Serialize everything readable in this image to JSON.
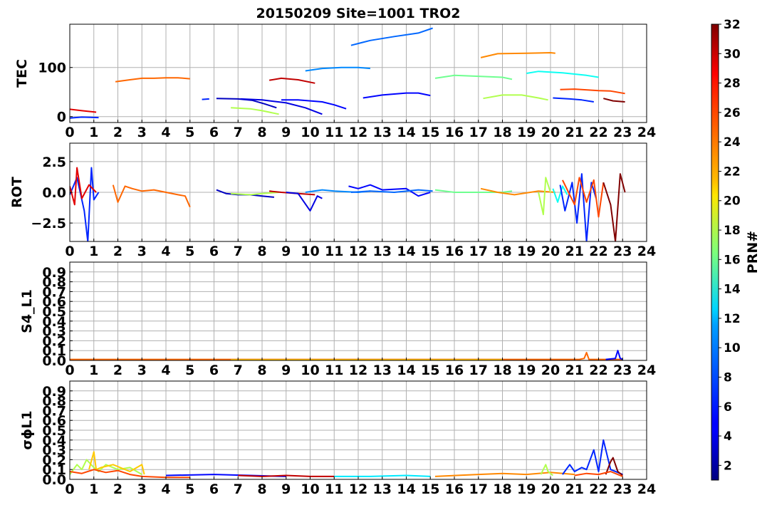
{
  "title": "20150209 Site=1001 TRO2",
  "colorbar": {
    "label": "PRN#",
    "ticks": [
      2,
      4,
      6,
      8,
      10,
      12,
      14,
      16,
      18,
      20,
      22,
      24,
      26,
      28,
      30,
      32
    ],
    "range": [
      1,
      32
    ],
    "colormap": "jet"
  },
  "chart_data": [
    {
      "type": "line",
      "ylabel": "TEC",
      "xlim": [
        0,
        24
      ],
      "ylim": [
        -12,
        188
      ],
      "xticks": [
        0,
        1,
        2,
        3,
        4,
        5,
        6,
        7,
        8,
        9,
        10,
        11,
        12,
        13,
        14,
        15,
        16,
        17,
        18,
        19,
        20,
        21,
        22,
        23,
        24
      ],
      "yticks": [
        0,
        100
      ],
      "grid": true,
      "series": [
        {
          "prn": 29,
          "x": [
            0.0,
            0.5,
            1.1
          ],
          "y": [
            15,
            12,
            9
          ]
        },
        {
          "prn": 6,
          "x": [
            0.0,
            0.5,
            1.2
          ],
          "y": [
            -3,
            -1,
            -2
          ]
        },
        {
          "prn": 25,
          "x": [
            1.9,
            2.5,
            3.0,
            3.5,
            4.0,
            4.5,
            5.0
          ],
          "y": [
            71,
            75,
            78,
            78,
            79,
            79,
            77
          ]
        },
        {
          "prn": 6,
          "x": [
            5.5,
            5.8
          ],
          "y": [
            35,
            36
          ]
        },
        {
          "prn": 3,
          "x": [
            6.1,
            7.0,
            7.6,
            8.1,
            8.6
          ],
          "y": [
            37,
            36,
            33,
            26,
            18
          ]
        },
        {
          "prn": 4,
          "x": [
            7.1,
            8.0,
            9.0,
            9.8,
            10.5
          ],
          "y": [
            36,
            34,
            28,
            18,
            5
          ]
        },
        {
          "prn": 5,
          "x": [
            8.8,
            9.5,
            10.5,
            11.0,
            11.5
          ],
          "y": [
            34,
            34,
            30,
            24,
            16
          ]
        },
        {
          "prn": 18,
          "x": [
            6.7,
            7.5,
            8.0,
            8.7
          ],
          "y": [
            18,
            16,
            12,
            5
          ]
        },
        {
          "prn": 30,
          "x": [
            8.3,
            8.8,
            9.5,
            10.2
          ],
          "y": [
            74,
            78,
            75,
            68
          ]
        },
        {
          "prn": 9,
          "x": [
            9.8,
            10.5,
            11.3,
            12.0,
            12.5
          ],
          "y": [
            93,
            98,
            100,
            100,
            98
          ]
        },
        {
          "prn": 8,
          "x": [
            11.7,
            12.5,
            13.5,
            14.5,
            15.1
          ],
          "y": [
            145,
            155,
            163,
            170,
            180
          ]
        },
        {
          "prn": 5,
          "x": [
            12.2,
            13.0,
            14.0,
            14.5,
            15.0
          ],
          "y": [
            38,
            44,
            48,
            48,
            43
          ]
        },
        {
          "prn": 16,
          "x": [
            15.2,
            16.0,
            17.0,
            18.0,
            18.4
          ],
          "y": [
            78,
            84,
            82,
            80,
            76
          ]
        },
        {
          "prn": 24,
          "x": [
            17.1,
            17.8,
            19.0,
            20.0,
            20.2
          ],
          "y": [
            120,
            128,
            129,
            130,
            129
          ]
        },
        {
          "prn": 18,
          "x": [
            17.2,
            18.0,
            18.8,
            19.5,
            19.9
          ],
          "y": [
            37,
            44,
            44,
            38,
            34
          ]
        },
        {
          "prn": 13,
          "x": [
            19.0,
            19.5,
            20.5,
            21.5,
            22.0
          ],
          "y": [
            88,
            92,
            89,
            84,
            80
          ]
        },
        {
          "prn": 26,
          "x": [
            20.4,
            21.0,
            22.0,
            22.5,
            23.1
          ],
          "y": [
            55,
            56,
            53,
            52,
            47
          ]
        },
        {
          "prn": 6,
          "x": [
            20.1,
            20.8,
            21.3,
            21.8
          ],
          "y": [
            38,
            36,
            34,
            30
          ]
        },
        {
          "prn": 32,
          "x": [
            22.2,
            22.6,
            23.1
          ],
          "y": [
            37,
            32,
            30
          ]
        }
      ]
    },
    {
      "type": "line",
      "ylabel": "ROT",
      "xlim": [
        0,
        24
      ],
      "ylim": [
        -4,
        4
      ],
      "xticks": [
        0,
        1,
        2,
        3,
        4,
        5,
        6,
        7,
        8,
        9,
        10,
        11,
        12,
        13,
        14,
        15,
        16,
        17,
        18,
        19,
        20,
        21,
        22,
        23,
        24
      ],
      "yticks": [
        -2.5,
        0.0,
        2.5
      ],
      "ytick_labels": [
        "−2.5",
        "0.0",
        "2.5"
      ],
      "grid": true,
      "series": [
        {
          "prn": 6,
          "x": [
            0.0,
            0.3,
            0.6,
            0.75,
            0.9,
            1.0,
            1.2
          ],
          "y": [
            -0.2,
            1.2,
            -1.5,
            -4.0,
            2.0,
            -0.6,
            0.0
          ]
        },
        {
          "prn": 29,
          "x": [
            0.0,
            0.2,
            0.3,
            0.5,
            0.8,
            1.1
          ],
          "y": [
            0.5,
            -1.0,
            2.0,
            -0.5,
            0.6,
            0.0
          ]
        },
        {
          "prn": 25,
          "x": [
            1.8,
            2.0,
            2.3,
            2.6,
            3.0,
            3.5,
            4.0,
            4.5,
            4.8,
            5.0
          ],
          "y": [
            0.6,
            -0.8,
            0.5,
            0.3,
            0.1,
            0.2,
            0.0,
            -0.2,
            -0.3,
            -1.2
          ]
        },
        {
          "prn": 3,
          "x": [
            6.1,
            6.5,
            7.0,
            7.5,
            8.0,
            8.5
          ],
          "y": [
            0.2,
            -0.1,
            -0.2,
            -0.2,
            -0.3,
            -0.4
          ]
        },
        {
          "prn": 18,
          "x": [
            6.7,
            7.5,
            8.0,
            8.7
          ],
          "y": [
            -0.1,
            -0.2,
            -0.1,
            0.0
          ]
        },
        {
          "prn": 30,
          "x": [
            8.3,
            8.8,
            9.5,
            10.2
          ],
          "y": [
            0.1,
            0.0,
            -0.1,
            -0.2
          ]
        },
        {
          "prn": 4,
          "x": [
            9.0,
            9.5,
            10.0,
            10.3,
            10.5
          ],
          "y": [
            0.0,
            -0.1,
            -1.5,
            -0.3,
            -0.5
          ]
        },
        {
          "prn": 9,
          "x": [
            9.8,
            10.5,
            11.0,
            12.0,
            12.5
          ],
          "y": [
            0.0,
            0.2,
            0.1,
            0.0,
            0.1
          ]
        },
        {
          "prn": 5,
          "x": [
            11.6,
            12.0,
            12.5,
            13.0,
            14.0,
            14.5,
            15.0
          ],
          "y": [
            0.5,
            0.3,
            0.6,
            0.2,
            0.3,
            -0.3,
            0.0
          ]
        },
        {
          "prn": 8,
          "x": [
            11.7,
            12.5,
            13.5,
            14.5,
            15.1
          ],
          "y": [
            0.0,
            0.1,
            0.0,
            0.2,
            0.1
          ]
        },
        {
          "prn": 16,
          "x": [
            15.2,
            16.0,
            17.0,
            18.0,
            18.4
          ],
          "y": [
            0.2,
            0.0,
            0.0,
            0.0,
            0.1
          ]
        },
        {
          "prn": 24,
          "x": [
            17.1,
            17.8,
            18.5,
            19.5,
            20.2
          ],
          "y": [
            0.3,
            0.0,
            -0.2,
            0.1,
            0.0
          ]
        },
        {
          "prn": 18,
          "x": [
            19.5,
            19.7,
            19.8,
            20.0
          ],
          "y": [
            0.0,
            -1.8,
            1.2,
            0.0
          ]
        },
        {
          "prn": 13,
          "x": [
            20.1,
            20.3,
            20.5,
            20.7
          ],
          "y": [
            0.3,
            -0.8,
            0.5,
            -0.2
          ]
        },
        {
          "prn": 6,
          "x": [
            20.4,
            20.6,
            20.9,
            21.1,
            21.3,
            21.5,
            21.7,
            21.9
          ],
          "y": [
            0.6,
            -1.5,
            0.8,
            -2.5,
            1.5,
            -4.0,
            0.8,
            -0.5
          ]
        },
        {
          "prn": 26,
          "x": [
            20.5,
            21.0,
            21.2,
            21.5,
            21.8,
            22.0,
            22.2
          ],
          "y": [
            1.0,
            -1.0,
            1.2,
            -0.8,
            1.0,
            -2.0,
            0.8
          ]
        },
        {
          "prn": 32,
          "x": [
            22.2,
            22.5,
            22.7,
            22.9,
            23.1
          ],
          "y": [
            0.8,
            -1.0,
            -4.0,
            1.5,
            0.0
          ]
        }
      ]
    },
    {
      "type": "line",
      "ylabel": "S4_L1",
      "xlim": [
        0,
        24
      ],
      "ylim": [
        0,
        1.0
      ],
      "xticks": [
        0,
        1,
        2,
        3,
        4,
        5,
        6,
        7,
        8,
        9,
        10,
        11,
        12,
        13,
        14,
        15,
        16,
        17,
        18,
        19,
        20,
        21,
        22,
        23,
        24
      ],
      "yticks": [
        0.0,
        0.1,
        0.2,
        0.3,
        0.4,
        0.5,
        0.6,
        0.7,
        0.8,
        0.9
      ],
      "grid": true,
      "series": [
        {
          "prn": 25,
          "x": [
            0.0,
            5.0,
            10.0,
            15.0,
            20.0,
            21.2,
            21.4,
            21.5,
            21.6,
            23.0
          ],
          "y": [
            0.01,
            0.01,
            0.01,
            0.01,
            0.01,
            0.01,
            0.02,
            0.08,
            0.01,
            0.01
          ]
        },
        {
          "prn": 22,
          "x": [
            6.7,
            12.0,
            18.0
          ],
          "y": [
            0.005,
            0.005,
            0.005
          ]
        },
        {
          "prn": 5,
          "x": [
            22.3,
            22.7,
            22.8,
            22.9,
            23.0
          ],
          "y": [
            0.01,
            0.02,
            0.1,
            0.02,
            0.01
          ]
        }
      ]
    },
    {
      "type": "line",
      "ylabel": "σϕL1",
      "xlim": [
        0,
        24
      ],
      "ylim": [
        0,
        1.0
      ],
      "xticks": [
        0,
        1,
        2,
        3,
        4,
        5,
        6,
        7,
        8,
        9,
        10,
        11,
        12,
        13,
        14,
        15,
        16,
        17,
        18,
        19,
        20,
        21,
        22,
        23,
        24
      ],
      "yticks": [
        0.0,
        0.1,
        0.2,
        0.3,
        0.4,
        0.5,
        0.6,
        0.7,
        0.8,
        0.9
      ],
      "grid": true,
      "series": [
        {
          "prn": 18,
          "x": [
            0.0,
            0.3,
            0.5,
            0.7,
            1.0,
            1.2,
            1.5,
            2.0,
            2.5,
            3.0
          ],
          "y": [
            0.05,
            0.15,
            0.1,
            0.2,
            0.12,
            0.08,
            0.15,
            0.1,
            0.12,
            0.05
          ]
        },
        {
          "prn": 22,
          "x": [
            0.8,
            1.0,
            1.1,
            1.3,
            1.8,
            2.5,
            3.0,
            3.1
          ],
          "y": [
            0.1,
            0.28,
            0.1,
            0.12,
            0.15,
            0.08,
            0.15,
            0.05
          ]
        },
        {
          "prn": 26,
          "x": [
            0.0,
            0.5,
            1.0,
            1.5,
            2.0,
            2.5,
            3.0,
            4.0,
            5.0
          ],
          "y": [
            0.08,
            0.06,
            0.1,
            0.07,
            0.09,
            0.05,
            0.03,
            0.02,
            0.02
          ]
        },
        {
          "prn": 5,
          "x": [
            4.0,
            6.0,
            7.5,
            9.0
          ],
          "y": [
            0.04,
            0.05,
            0.04,
            0.03
          ]
        },
        {
          "prn": 30,
          "x": [
            7.0,
            8.0,
            9.0,
            10.0,
            11.0
          ],
          "y": [
            0.04,
            0.03,
            0.04,
            0.03,
            0.03
          ]
        },
        {
          "prn": 12,
          "x": [
            11.0,
            12.5,
            14.0,
            15.0
          ],
          "y": [
            0.03,
            0.03,
            0.04,
            0.03
          ]
        },
        {
          "prn": 24,
          "x": [
            15.2,
            17.0,
            18.0,
            19.0,
            20.0,
            21.0
          ],
          "y": [
            0.03,
            0.05,
            0.06,
            0.05,
            0.07,
            0.05
          ]
        },
        {
          "prn": 18,
          "x": [
            19.6,
            19.8,
            19.9,
            20.1
          ],
          "y": [
            0.05,
            0.15,
            0.08,
            0.04
          ]
        },
        {
          "prn": 6,
          "x": [
            20.5,
            20.8,
            21.0,
            21.3,
            21.5,
            21.8,
            22.0,
            22.2,
            22.5,
            23.0
          ],
          "y": [
            0.05,
            0.15,
            0.08,
            0.12,
            0.1,
            0.3,
            0.08,
            0.4,
            0.1,
            0.05
          ]
        },
        {
          "prn": 32,
          "x": [
            22.3,
            22.5,
            22.6,
            22.8,
            23.0
          ],
          "y": [
            0.05,
            0.18,
            0.22,
            0.08,
            0.04
          ]
        },
        {
          "prn": 26,
          "x": [
            21.0,
            21.5,
            22.0,
            22.5,
            23.0
          ],
          "y": [
            0.04,
            0.06,
            0.05,
            0.08,
            0.03
          ]
        }
      ]
    }
  ]
}
